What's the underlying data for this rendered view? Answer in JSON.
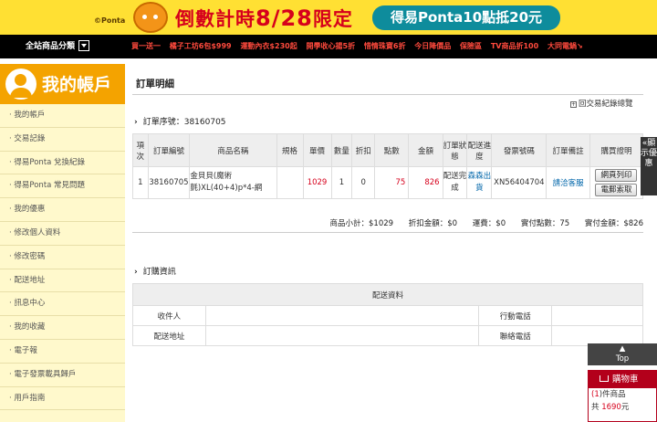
{
  "banner": {
    "brand": "©Ponta",
    "headline_pre": "倒數計時",
    "headline_date": "8/28",
    "headline_post": "限定",
    "pill": "得易Ponta10點抵20元"
  },
  "nav": {
    "all_categories": "全站商品分類",
    "links": [
      "買一送一",
      "橘子工坊6包$999",
      "運動內衣$230起",
      "開學收心揚5折",
      "惜情珠寶6折",
      "今日降價品",
      "保險區",
      "TV商品折100",
      "大同電鍋↘"
    ]
  },
  "sidebar": {
    "title": "我的帳戶",
    "items": [
      "我的帳戶",
      "交易記錄",
      "得易Ponta 兌換紀錄",
      "得易Ponta 常見問題",
      "我的優惠",
      "修改個人資料",
      "修改密碼",
      "配送地址",
      "訊息中心",
      "我的收藏",
      "電子報",
      "電子發票載具歸戶",
      "用戶指南"
    ]
  },
  "page": {
    "title": "訂單明細",
    "back_link": "回交易紀錄總覽",
    "order_serial_label": "訂單序號：38160705"
  },
  "order_table": {
    "headers": [
      "項次",
      "訂單編號",
      "商品名稱",
      "規格",
      "單價",
      "數量",
      "折扣",
      "點數",
      "金額",
      "訂單狀態",
      "配送進度",
      "發票號碼",
      "訂單備註",
      "購買證明"
    ],
    "row": {
      "idx": "1",
      "order_id": "38160705",
      "product": "金貝貝(魔術氈)XL(40+4)p*4-網",
      "spec": "",
      "price": "1029",
      "qty": "1",
      "discount": "0",
      "points": "75",
      "amount": "826",
      "status": "配送完成",
      "progress": "森森出貨",
      "invoice": "XN56404704",
      "note": "請洽客服",
      "btn_print": "網頁列印",
      "btn_mail": "電郵索取"
    }
  },
  "summary": {
    "subtotal": "商品小計：$1029",
    "discount": "折扣金額：$0",
    "shipping": "運費：$0",
    "points": "實付點數：75",
    "paid": "實付金額：$826"
  },
  "purchase_info": {
    "section_title": "訂購資訊",
    "delivery_header": "配送資料",
    "recipient_label": "收件人",
    "mobile_label": "行動電話",
    "address_label": "配送地址",
    "phone_label": "聯絡電話"
  },
  "widgets": {
    "promo_tab": "«顯示優惠",
    "top_label": "Top",
    "cart_title": "購物車",
    "cart_count_pre": "(",
    "cart_count": "1",
    "cart_count_post": ")件商品",
    "cart_total_pre": "共 ",
    "cart_total": "1690",
    "cart_total_post": "元"
  }
}
